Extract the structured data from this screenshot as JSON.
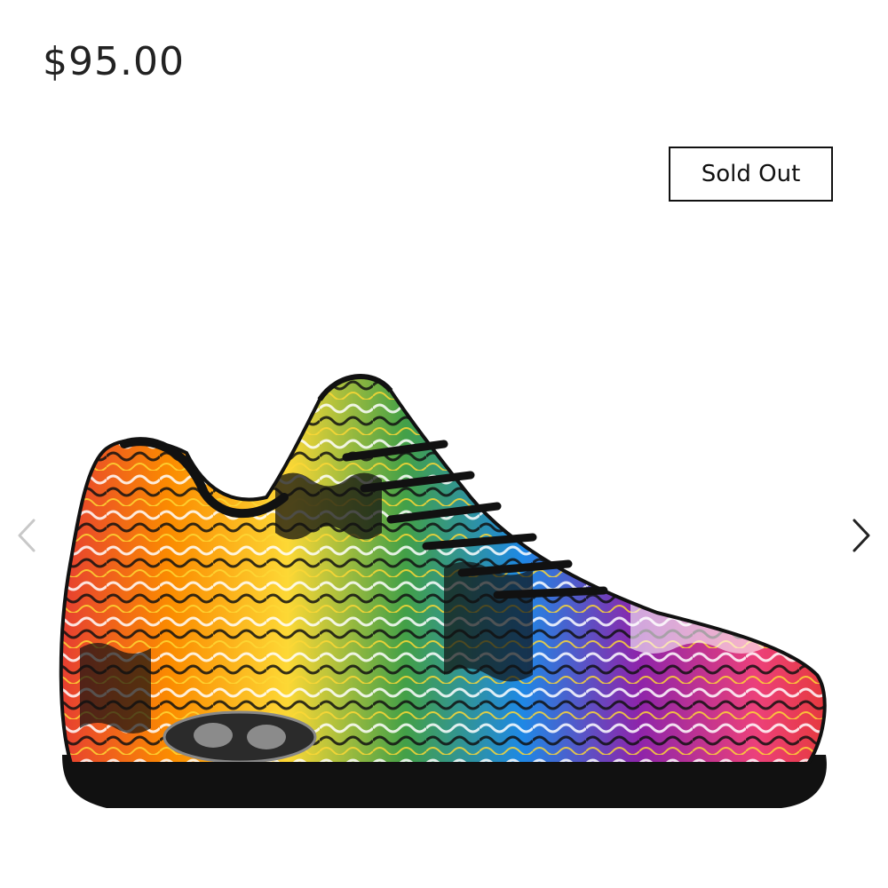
{
  "product": {
    "price": "$95.00",
    "status_badge": "Sold Out"
  },
  "gallery": {
    "prev_icon": "chevron-left-icon",
    "next_icon": "chevron-right-icon",
    "image": "colorful-melting-pattern-sneaker"
  },
  "colors": {
    "text": "#222222",
    "badge_border": "#111111",
    "prev_arrow": "#c8c8c8",
    "next_arrow": "#222222"
  }
}
